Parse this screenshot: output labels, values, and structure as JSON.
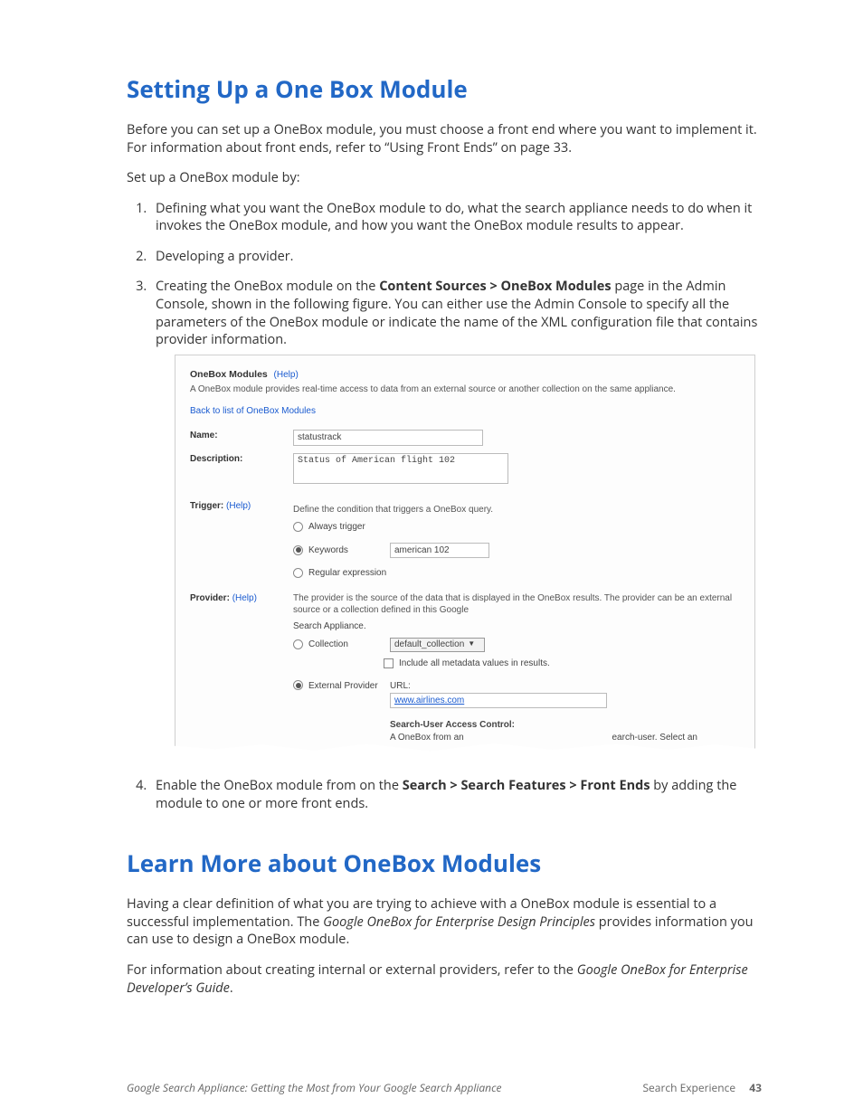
{
  "sections": {
    "setup": {
      "title": "Setting Up a One Box Module",
      "intro1": "Before you can set up a OneBox module, you must choose a front end where you want to implement it. For information about front ends, refer to “Using Front Ends” on page 33.",
      "intro2": "Set up a OneBox module by:",
      "step1": "Defining what you want the OneBox module to do, what the search appliance needs to do when it invokes the OneBox module, and how you want the OneBox module results to appear.",
      "step2": "Developing a provider.",
      "step3_a": "Creating the OneBox module on the ",
      "step3_bold": "Content Sources > OneBox Modules",
      "step3_b": " page in the Admin Console, shown in the following figure. You can either use the Admin Console to specify all the parameters of the OneBox module or indicate the name of the XML configuration file that contains provider information.",
      "step4_a": "Enable the OneBox module from on the ",
      "step4_bold": "Search > Search Features > Front Ends",
      "step4_b": " by adding the module to one or more front ends."
    },
    "learn": {
      "title": "Learn More about OneBox Modules",
      "p1_a": "Having a clear definition of what you are trying to achieve with a OneBox module is essential to a successful implementation. The ",
      "p1_italic": "Google OneBox for Enterprise Design Principles",
      "p1_b": " provides information you can use to design a OneBox module.",
      "p2_a": "For information about creating internal or external providers, refer to the ",
      "p2_italic": "Google OneBox for Enterprise Developer’s Guide",
      "p2_b": "."
    }
  },
  "figure": {
    "panel_title": "OneBox Modules",
    "help": "(Help)",
    "panel_sub": "A OneBox module provides real-time access to data from an external source or another collection on the same appliance.",
    "back_link": "Back to list of OneBox Modules",
    "labels": {
      "name": "Name:",
      "description": "Description:",
      "trigger": "Trigger:",
      "provider": "Provider:"
    },
    "name_value": "statustrack",
    "description_value": "Status of American flight 102",
    "trigger": {
      "note": "Define the condition that triggers a OneBox query.",
      "always": "Always trigger",
      "keywords": "Keywords",
      "keywords_value": "american 102",
      "regex": "Regular expression"
    },
    "provider": {
      "note": "The provider is the source of the data that is displayed in the OneBox results. The provider can be an external source or a collection defined in this Google",
      "search_appliance": "Search Appliance.",
      "collection": "Collection",
      "collection_value": "default_collection",
      "include_metadata": "Include all metadata values in results.",
      "external": "External Provider",
      "url_label": "URL:",
      "url_value": "www.airlines.com",
      "access_control": "Search-User Access Control:",
      "access_note_a": "A OneBox from an",
      "access_note_b": "earch-user. Select an"
    }
  },
  "footer": {
    "left": "Google Search Appliance: Getting the Most from Your Google Search Appliance",
    "right_label": "Search Experience",
    "page": "43"
  }
}
